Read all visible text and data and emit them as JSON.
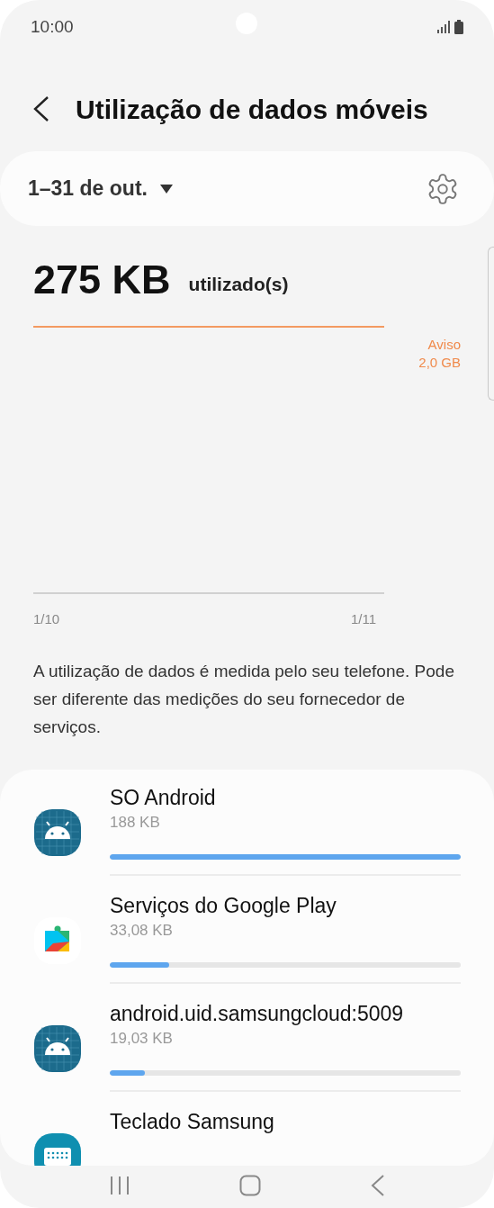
{
  "status_bar": {
    "time": "10:00"
  },
  "header": {
    "title": "Utilização de dados móveis"
  },
  "period": {
    "label": "1–31 de out."
  },
  "usage": {
    "amount": "275 KB",
    "unit": "utilizado(s)"
  },
  "chart": {
    "warning_label": "Aviso",
    "warning_value": "2,0 GB",
    "start_label": "1/10",
    "end_label": "1/11"
  },
  "note": "A utilização de dados é medida pelo seu telefone. Pode ser diferente das medições do seu fornecedor de serviços.",
  "apps": [
    {
      "kind": "android",
      "name": "SO Android",
      "size": "188 KB",
      "level": 1.0
    },
    {
      "kind": "play",
      "name": "Serviços do Google Play",
      "size": "33,08 KB",
      "level": 0.17
    },
    {
      "kind": "android",
      "name": "android.uid.samsungcloud:5009",
      "size": "19,03 KB",
      "level": 0.1
    },
    {
      "kind": "keyboard",
      "name": "Teclado Samsung"
    }
  ]
}
